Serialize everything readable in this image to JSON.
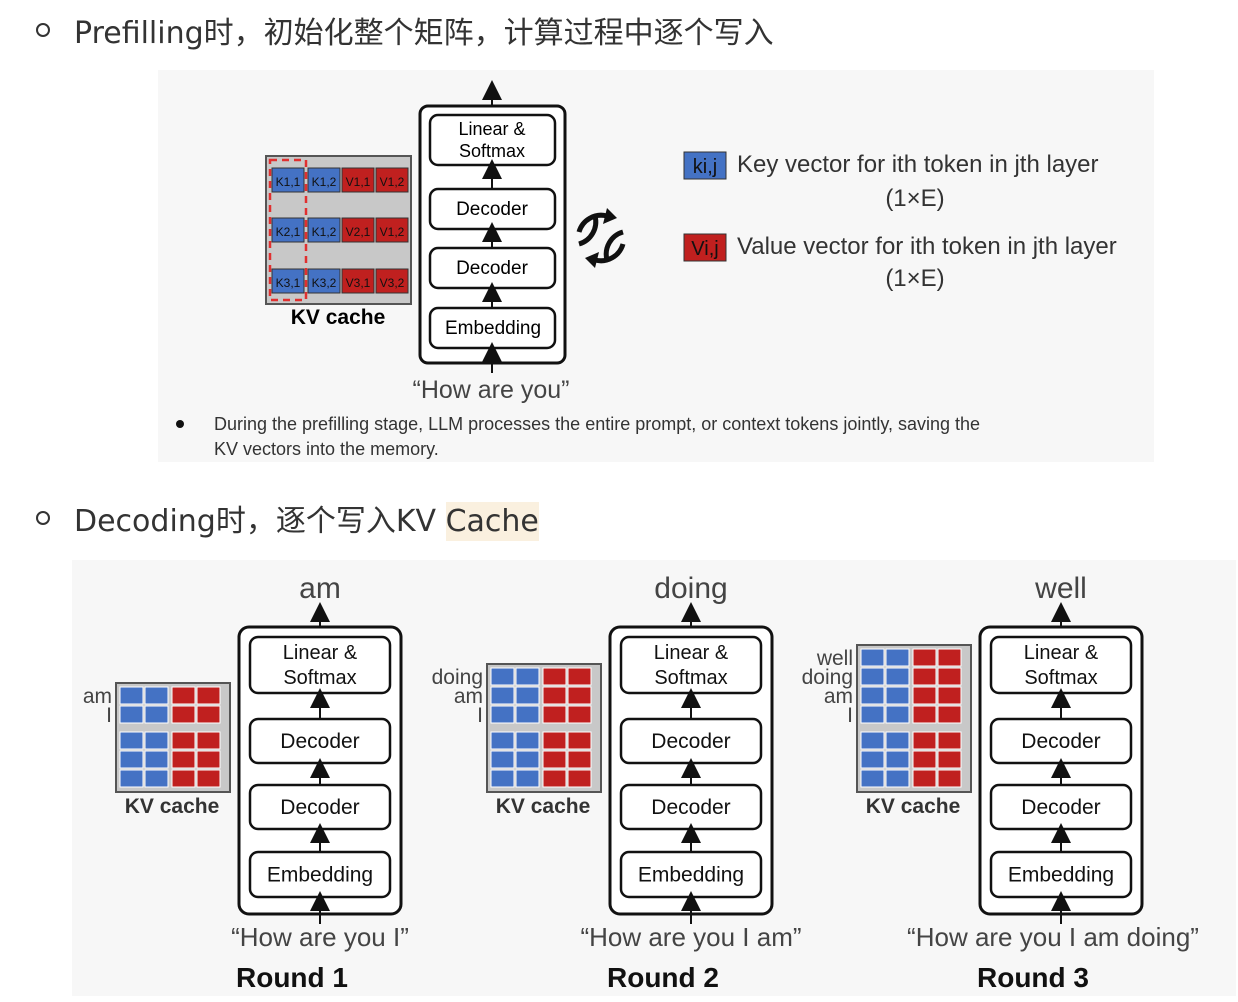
{
  "bullets": {
    "prefill": "Prefilling时，初始化整个矩阵，计算过程中逐个写入",
    "decode_prefix": "Decoding时，逐个写入KV ",
    "decode_highlight": "Cache"
  },
  "prefill_figure": {
    "stack": {
      "top": "Linear &",
      "top2": "Softmax",
      "dec1": "Decoder",
      "dec2": "Decoder",
      "emb": "Embedding"
    },
    "kv_label": "KV cache",
    "prompt": "“How are you”",
    "cells": [
      [
        "K1,1",
        "K1,2",
        "V1,1",
        "V1,2"
      ],
      [
        "K2,1",
        "K1,2",
        "V2,1",
        "V1,2"
      ],
      [
        "K3,1",
        "K3,2",
        "V3,1",
        "V3,2"
      ]
    ],
    "legend": {
      "key_chip": "ki,j",
      "key_text": "Key vector for ith token in jth layer",
      "key_dim": "(1×E)",
      "val_chip": "Vi,j",
      "val_text": "Value vector for ith token in jth layer",
      "val_dim": "(1×E)"
    },
    "note_line1": "During the prefilling stage, LLM processes the entire prompt, or context tokens jointly, saving the",
    "note_line2": "KV vectors into the memory."
  },
  "rounds": [
    {
      "output": "am",
      "tokens": [
        "am",
        "I"
      ],
      "prompt": "“How are you I”",
      "title": "Round 1",
      "stack": {
        "top": "Linear &",
        "top2": "Softmax",
        "dec1": "Decoder",
        "dec2": "Decoder",
        "emb": "Embedding"
      },
      "kv_label": "KV cache"
    },
    {
      "output": "doing",
      "tokens": [
        "doing",
        "am",
        "I"
      ],
      "prompt": "“How are you I am”",
      "title": "Round 2",
      "stack": {
        "top": "Linear &",
        "top2": "Softmax",
        "dec1": "Decoder",
        "dec2": "Decoder",
        "emb": "Embedding"
      },
      "kv_label": "KV cache"
    },
    {
      "output": "well",
      "tokens": [
        "well",
        "doing",
        "am",
        "I"
      ],
      "prompt": "“How are you I am doing”",
      "title": "Round 3",
      "stack": {
        "top": "Linear &",
        "top2": "Softmax",
        "dec1": "Decoder",
        "dec2": "Decoder",
        "emb": "Embedding"
      },
      "kv_label": "KV cache"
    }
  ],
  "colors": {
    "key": "#4472c4",
    "value": "#c0201f",
    "cache_bg": "#c8c8c8",
    "dash": "#e03030"
  }
}
